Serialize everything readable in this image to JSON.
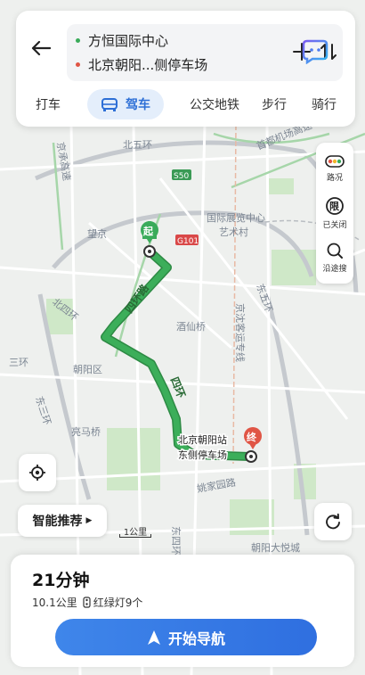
{
  "route": {
    "origin": "方恒国际中心",
    "destination": "北京朝阳...侧停车场"
  },
  "modes": [
    {
      "label": "打车",
      "active": false
    },
    {
      "label": "驾车",
      "active": true
    },
    {
      "label": "公交地铁",
      "active": false
    },
    {
      "label": "步行",
      "active": false
    },
    {
      "label": "骑行",
      "active": false
    }
  ],
  "tools": {
    "traffic": "路况",
    "restriction": "已关闭",
    "restriction_glyph": "限",
    "search_along": "沿途搜"
  },
  "map": {
    "start_marker": "起",
    "end_marker": "终",
    "dest_label_line1": "北京朝阳站",
    "dest_label_line2": "东侧停车场",
    "labels": {
      "north5": "北五环",
      "airport_exp": "首都机场高速",
      "jingcheng": "京承高速",
      "s50": "S50",
      "g101": "G101",
      "wangjing": "望京",
      "expo": "国际展览中心",
      "artzone": "艺术村",
      "north4": "北四环",
      "jiuxianqiao": "酒仙桥",
      "chaoyang": "朝阳区",
      "east4_label": "东四环",
      "east5": "东五环",
      "liangmaqiao": "亮马桥",
      "yaojiayuan": "姚家园路",
      "chaoyang_joy": "朝阳大悦城",
      "jingshen": "京沈客运专线",
      "sanhuan": "三环",
      "east3": "东三环",
      "mid_ring": "机场",
      "east4_bottom": "东四环",
      "route_ring_upper": "四环路",
      "route_ring_lower": "四环"
    }
  },
  "floating": {
    "recommend": "智能推荐",
    "scale": "1公里"
  },
  "summary": {
    "duration": "21分钟",
    "distance": "10.1公里",
    "traffic_lights": "红绿灯9个",
    "start_nav": "开始导航"
  },
  "colors": {
    "route": "#3cae5a",
    "accent": "#2f6fe0",
    "start_marker": "#3aab5a",
    "end_marker": "#e05545"
  }
}
